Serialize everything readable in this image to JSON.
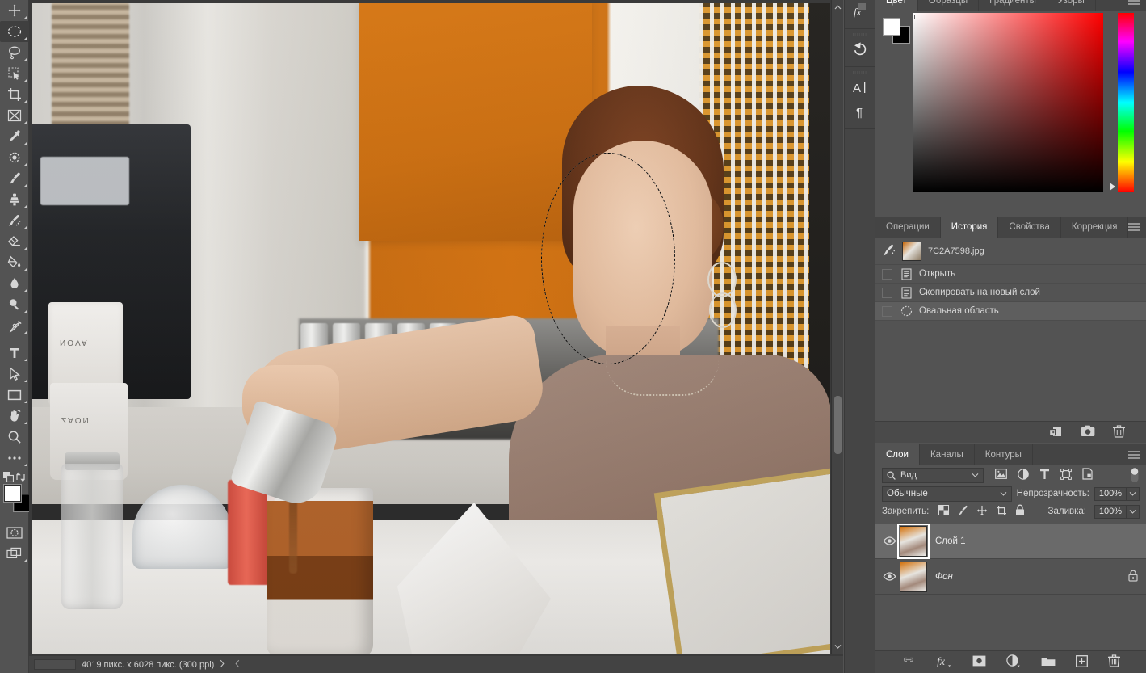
{
  "toolbar": {
    "tools": [
      {
        "name": "move-tool",
        "icon": "move"
      },
      {
        "name": "elliptical-marquee-tool",
        "icon": "ellipse-marquee",
        "active": true
      },
      {
        "name": "lasso-tool",
        "icon": "lasso"
      },
      {
        "name": "quick-selection-tool",
        "icon": "quick-select"
      },
      {
        "name": "crop-tool",
        "icon": "crop"
      },
      {
        "name": "frame-tool",
        "icon": "frame"
      },
      {
        "name": "eyedropper-tool",
        "icon": "eyedropper"
      },
      {
        "name": "spot-healing-brush-tool",
        "icon": "healing"
      },
      {
        "name": "brush-tool",
        "icon": "brush"
      },
      {
        "name": "clone-stamp-tool",
        "icon": "stamp"
      },
      {
        "name": "history-brush-tool",
        "icon": "history-brush"
      },
      {
        "name": "eraser-tool",
        "icon": "eraser"
      },
      {
        "name": "gradient-tool",
        "icon": "paint-bucket"
      },
      {
        "name": "blur-tool",
        "icon": "droplet"
      },
      {
        "name": "dodge-tool",
        "icon": "dodge"
      },
      {
        "name": "pen-tool",
        "icon": "pen"
      },
      {
        "name": "type-tool",
        "icon": "text-T"
      },
      {
        "name": "path-selection-tool",
        "icon": "arrow-pointer"
      },
      {
        "name": "rectangle-tool",
        "icon": "rectangle"
      },
      {
        "name": "hand-tool",
        "icon": "hand"
      },
      {
        "name": "zoom-tool",
        "icon": "magnifier"
      },
      {
        "name": "edit-toolbar-button",
        "icon": "ellipsis"
      }
    ],
    "colors": {
      "foreground": "#ffffff",
      "background": "#000000"
    },
    "quick_mask_name": "quick-mask-toggle",
    "screen_mode_name": "screen-mode-toggle"
  },
  "canvas": {
    "status": {
      "dimensions": "4019 пикс. x 6028 пикс. (300 ppi)"
    },
    "selection": {
      "type": "ellipse",
      "shape_name": "marching-ants-ellipse"
    }
  },
  "mini_dock": {
    "items": [
      {
        "name": "layer-styles-icon",
        "glyph": "fx"
      },
      {
        "name": "history-icon",
        "glyph": "undo-arrow"
      },
      {
        "name": "character-panel-icon",
        "glyph": "A"
      },
      {
        "name": "paragraph-panel-icon",
        "glyph": "¶"
      }
    ]
  },
  "color_panel": {
    "tabs": [
      {
        "label": "Цвет",
        "active": true
      },
      {
        "label": "Образцы",
        "active": false
      },
      {
        "label": "Градиенты",
        "active": false
      },
      {
        "label": "Узоры",
        "active": false
      }
    ],
    "foreground_color": "#ffffff",
    "background_color": "#000000",
    "picker_hue": "#ff0000"
  },
  "history_panel": {
    "tabs": [
      {
        "label": "Операции",
        "active": false
      },
      {
        "label": "История",
        "active": true
      },
      {
        "label": "Свойства",
        "active": false
      },
      {
        "label": "Коррекция",
        "active": false
      }
    ],
    "snapshot": {
      "label": "7C2A7598.jpg"
    },
    "states": [
      {
        "label": "Открыть",
        "icon": "document-icon",
        "active": false
      },
      {
        "label": "Скопировать на новый слой",
        "icon": "document-icon",
        "active": false
      },
      {
        "label": "Овальная область",
        "icon": "ellipse-selection-icon",
        "active": true
      }
    ],
    "footer": [
      {
        "name": "new-document-from-state-button",
        "icon": "new-doc"
      },
      {
        "name": "create-snapshot-button",
        "icon": "camera"
      },
      {
        "name": "delete-state-button",
        "icon": "trash"
      }
    ]
  },
  "layers_panel": {
    "tabs": [
      {
        "label": "Слои",
        "active": true
      },
      {
        "label": "Каналы",
        "active": false
      },
      {
        "label": "Контуры",
        "active": false
      }
    ],
    "filter": {
      "value": "Вид",
      "icons": [
        {
          "name": "filter-pixel-layers-icon"
        },
        {
          "name": "filter-adjustment-layers-icon"
        },
        {
          "name": "filter-type-layers-icon"
        },
        {
          "name": "filter-shape-layers-icon"
        },
        {
          "name": "filter-smart-object-layers-icon"
        }
      ]
    },
    "blend_mode": "Обычные",
    "opacity_label": "Непрозрачность:",
    "opacity_value": "100%",
    "lock_label": "Закрепить:",
    "lock_icons": [
      {
        "name": "lock-transparent-pixels-icon"
      },
      {
        "name": "lock-image-pixels-icon"
      },
      {
        "name": "lock-position-icon"
      },
      {
        "name": "lock-artboard-nesting-icon"
      },
      {
        "name": "lock-all-icon"
      }
    ],
    "fill_label": "Заливка:",
    "fill_value": "100%",
    "layers": [
      {
        "name": "Слой 1",
        "selected": true,
        "visible": true,
        "locked": false,
        "italic": false
      },
      {
        "name": "Фон",
        "selected": false,
        "visible": true,
        "locked": true,
        "italic": true
      }
    ],
    "footer": [
      {
        "name": "link-layers-button",
        "icon": "link"
      },
      {
        "name": "layer-style-button",
        "icon": "fx"
      },
      {
        "name": "add-layer-mask-button",
        "icon": "mask"
      },
      {
        "name": "new-adjustment-layer-button",
        "icon": "adjustment"
      },
      {
        "name": "new-group-button",
        "icon": "folder"
      },
      {
        "name": "new-layer-button",
        "icon": "plus"
      },
      {
        "name": "delete-layer-button",
        "icon": "trash"
      }
    ]
  }
}
